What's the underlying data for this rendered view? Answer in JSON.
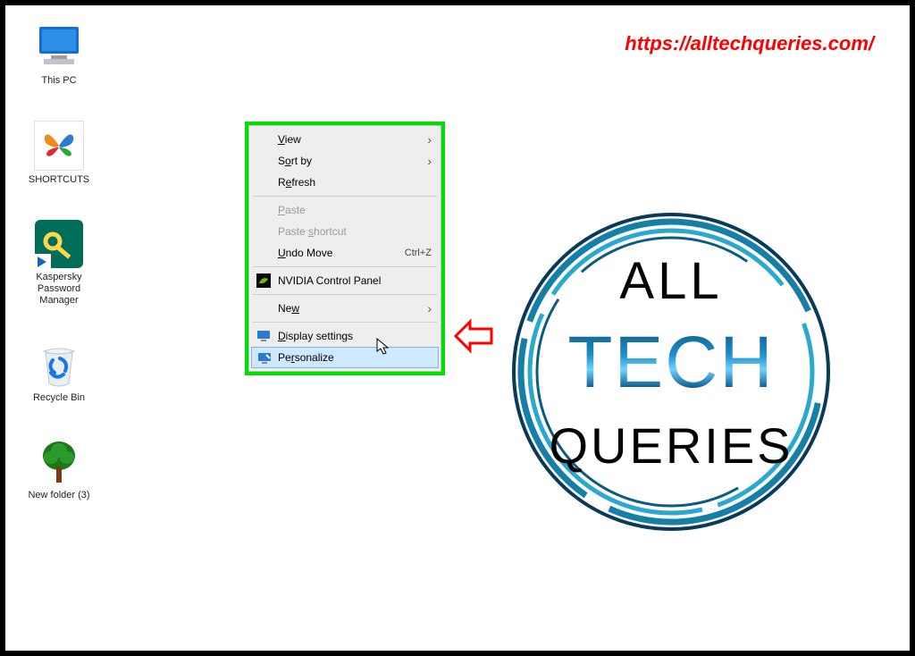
{
  "url_overlay": "https://alltechqueries.com/",
  "desktop_icons": [
    {
      "id": "this-pc",
      "label": "This PC"
    },
    {
      "id": "shortcuts",
      "label": "SHORTCUTS"
    },
    {
      "id": "kaspersky",
      "label": "Kaspersky Password\nManager"
    },
    {
      "id": "recycle-bin",
      "label": "Recycle Bin"
    },
    {
      "id": "new-folder",
      "label": "New folder (3)"
    }
  ],
  "context_menu": {
    "view": "View",
    "view_key": "V",
    "sort": "Sort by",
    "sort_key": "o",
    "refresh": "Refresh",
    "refresh_key": "e",
    "paste": "Paste",
    "paste_key": "P",
    "paste_shortcut": "Paste shortcut",
    "paste_shortcut_key": "s",
    "undo": "Undo Move",
    "undo_key": "U",
    "undo_accel": "Ctrl+Z",
    "nvidia": "NVIDIA Control Panel",
    "new": "New",
    "new_key": "w",
    "display": "Display settings",
    "display_key": "D",
    "personalize": "Personalize",
    "personalize_key": "r"
  },
  "logo": {
    "line1": "ALL",
    "line2": "TECH",
    "line3": "QUERIES"
  }
}
